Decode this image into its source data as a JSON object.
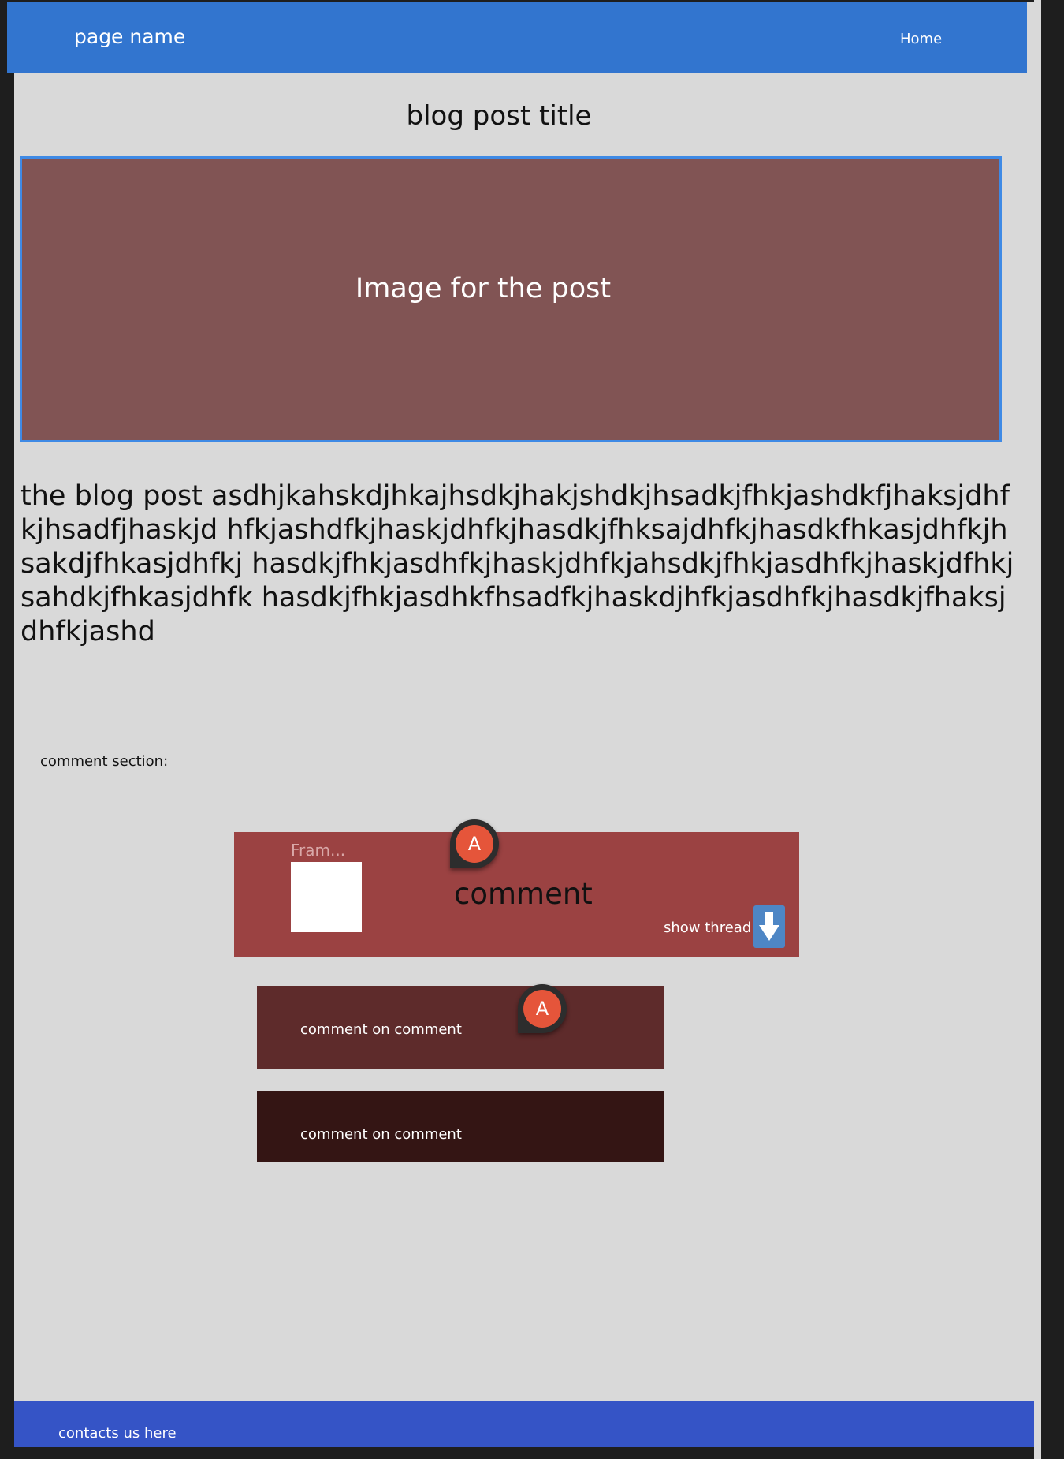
{
  "header": {
    "page_name": "page name",
    "home_label": "Home"
  },
  "post": {
    "title": "blog post title",
    "image_caption": "Image for the post",
    "body": "the blog post asdhjkahskdjhkajhsdkjhakjshdkjhsadkjfhkjashdkfjhaksjdhfkjhsadfjhaskjd hfkjashdfkjhaskjdhfkjhasdkjfhksajdhfkjhasdkfhkasjdhfkjhsakdjfhkasjdhfkj hasdkjfhkjasdhfkjhaskjdhfkjahsdkjfhkjasdhfkjhaskjdfhkjsahdkjfhkasjdhfk hasdkjfhkjasdhkfhsadfkjhaskdjhfkjasdhfkjhasdkjfhaksjdhfkjashd"
  },
  "comments": {
    "section_label": "comment section:",
    "main": {
      "frame_label": "Fram...",
      "text": "comment",
      "show_thread_label": "show thread"
    },
    "replies": [
      {
        "text": "comment on comment"
      },
      {
        "text": "comment on comment"
      }
    ],
    "marker_label": "A"
  },
  "footer": {
    "contact_label": "contacts us here"
  },
  "colors": {
    "header": "#3275cf",
    "footer": "#3554c6",
    "image_bg": "#815454",
    "comment_bg": "#9b4242",
    "reply1_bg": "#5e2b2b",
    "reply2_bg": "#341514",
    "marker": "#e5553a"
  }
}
